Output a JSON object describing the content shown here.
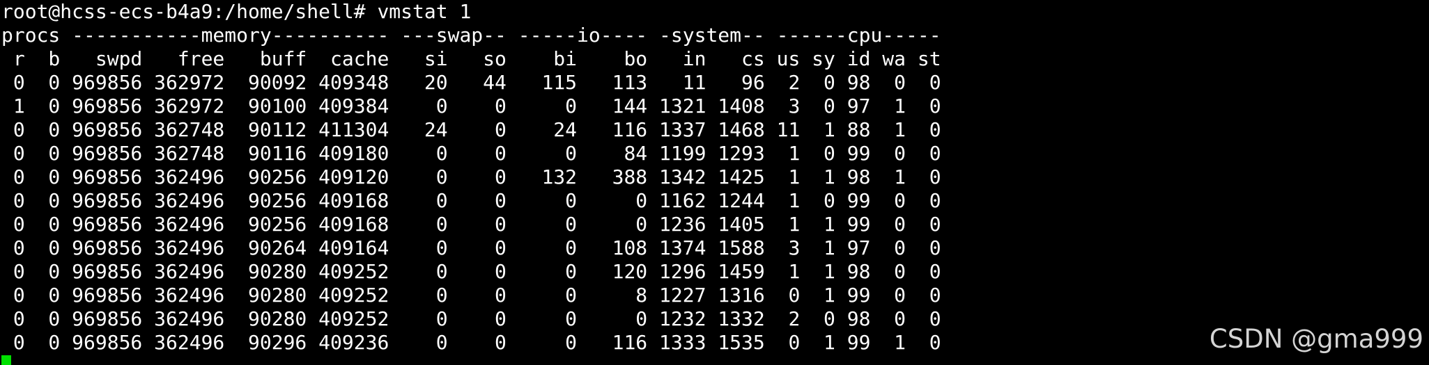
{
  "terminal": {
    "lines": [
      "root@hcss-ecs-b4a9:/home/shell# vmstat 1",
      "procs -----------memory---------- ---swap-- -----io---- -system-- ------cpu-----",
      " r  b   swpd   free   buff  cache   si   so    bi    bo   in   cs us sy id wa st",
      " 0  0 969856 362972  90092 409348   20   44   115   113   11   96  2  0 98  0  0",
      " 1  0 969856 362972  90100 409384    0    0     0   144 1321 1408  3  0 97  1  0",
      " 0  0 969856 362748  90112 411304   24    0    24   116 1337 1468 11  1 88  1  0",
      " 0  0 969856 362748  90116 409180    0    0     0    84 1199 1293  1  0 99  0  0",
      " 0  0 969856 362496  90256 409120    0    0   132   388 1342 1425  1  1 98  1  0",
      " 0  0 969856 362496  90256 409168    0    0     0     0 1162 1244  1  0 99  0  0",
      " 0  0 969856 362496  90256 409168    0    0     0     0 1236 1405  1  1 99  0  0",
      " 0  0 969856 362496  90264 409164    0    0     0   108 1374 1588  3  1 97  0  0",
      " 0  0 969856 362496  90280 409252    0    0     0   120 1296 1459  1  1 98  0  0",
      " 0  0 969856 362496  90280 409252    0    0     0     8 1227 1316  0  1 99  0  0",
      " 0  0 969856 362496  90280 409252    0    0     0     0 1232 1332  2  0 98  0  0",
      " 0  0 969856 362496  90296 409236    0    0     0   116 1333 1535  0  1 99  1  0"
    ],
    "text_color": "#ffffff",
    "background_color": "#000000",
    "cursor_color": "#00e000"
  },
  "watermark": {
    "text": "CSDN @gma999"
  }
}
